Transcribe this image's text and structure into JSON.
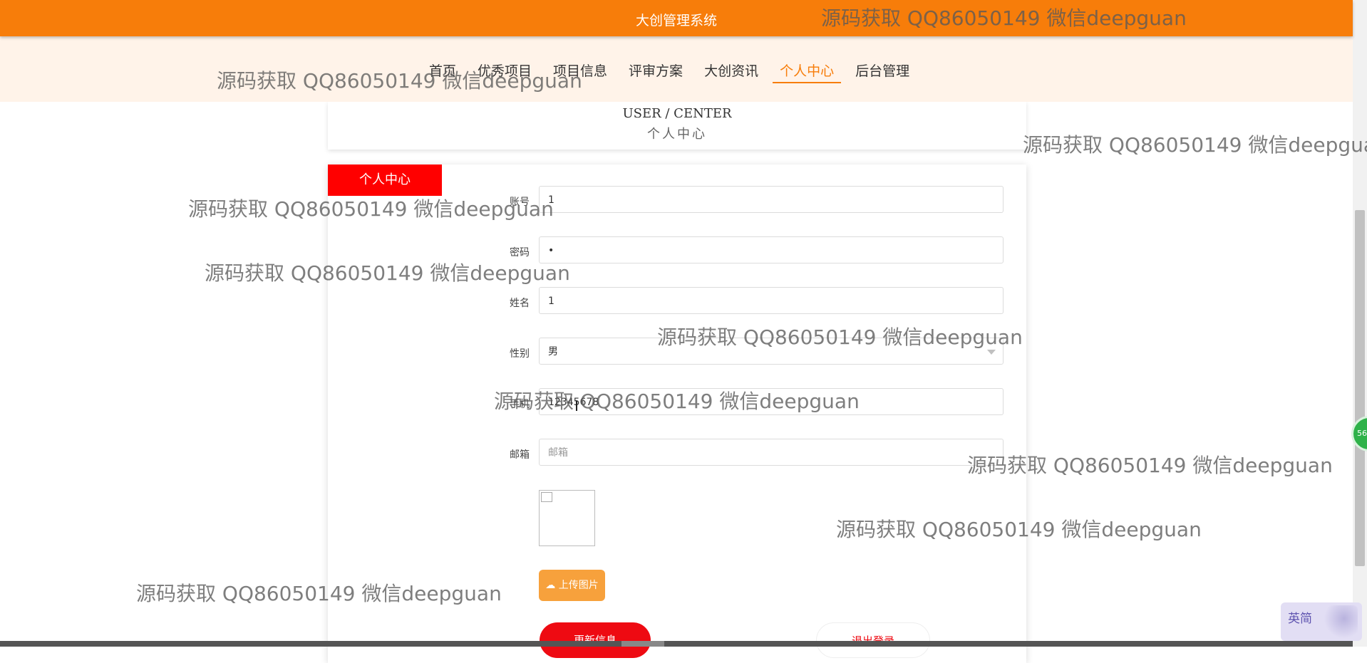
{
  "header": {
    "app_title": "大创管理系统"
  },
  "nav": {
    "items": [
      {
        "label": "首页"
      },
      {
        "label": "优秀项目"
      },
      {
        "label": "项目信息"
      },
      {
        "label": "评审方案"
      },
      {
        "label": "大创资讯"
      },
      {
        "label": "个人中心",
        "active": true
      },
      {
        "label": "后台管理"
      }
    ]
  },
  "section": {
    "title_en": "USER / CENTER",
    "title_cn": "个人中心"
  },
  "tab": {
    "label": "个人中心"
  },
  "form": {
    "account": {
      "label": "账号",
      "value": "1"
    },
    "password": {
      "label": "密码",
      "value": "•"
    },
    "name": {
      "label": "姓名",
      "value": "1"
    },
    "gender": {
      "label": "性别",
      "value": "男"
    },
    "phone": {
      "label": "手机",
      "value": "12345678"
    },
    "email": {
      "label": "邮箱",
      "placeholder": "邮箱"
    },
    "upload_label": "上传图片",
    "update_label": "更新信息",
    "logout_label": "退出登录"
  },
  "widgets": {
    "badge_text": "56",
    "ime_text": "英简"
  },
  "watermark": {
    "text": "源码获取 QQ86050149 微信deepguan"
  },
  "colors": {
    "primary": "#f77d0a",
    "nav_bg": "#fff3e9",
    "danger": "#ee0a12",
    "upload": "#f7a13c"
  }
}
